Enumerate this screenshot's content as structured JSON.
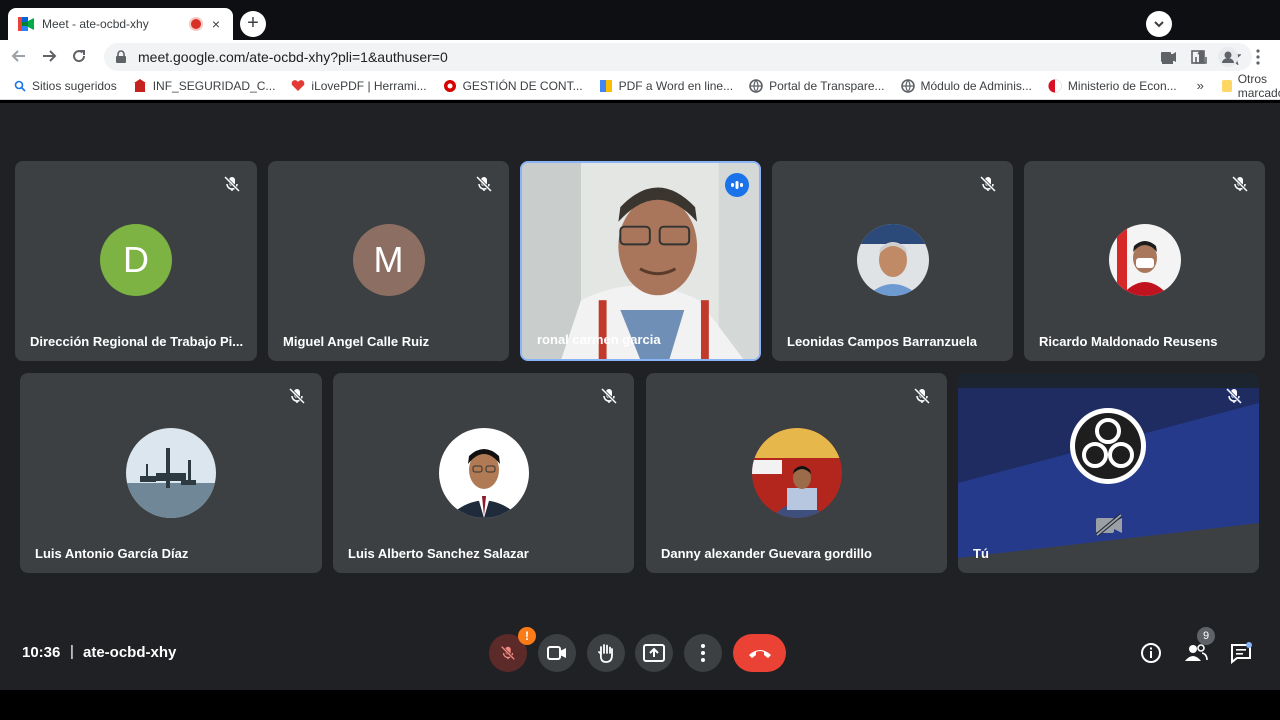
{
  "browser": {
    "tab_title": "Meet - ate-ocbd-xhy",
    "tab_close": "×",
    "new_tab": "+",
    "url": "meet.google.com/ate-ocbd-xhy?pli=1&authuser=0",
    "bookmarks": [
      {
        "label": "Sitios sugeridos",
        "icon": "search-icon",
        "color": "#1a73e8"
      },
      {
        "label": "INF_SEGURIDAD_C...",
        "icon": "building-icon",
        "color": "#c5221f"
      },
      {
        "label": "iLovePDF | Herrami...",
        "icon": "heart-icon",
        "color": "#e53935"
      },
      {
        "label": "GESTIÓN DE CONT...",
        "icon": "circle-logo-icon",
        "color": "#d50000"
      },
      {
        "label": "PDF a Word en line...",
        "icon": "pdf-icon",
        "color": "#fbbc04"
      },
      {
        "label": "Portal de Transpare...",
        "icon": "globe-icon",
        "color": "#5f6368"
      },
      {
        "label": "Módulo de Adminis...",
        "icon": "globe-icon",
        "color": "#5f6368"
      },
      {
        "label": "Ministerio de Econ...",
        "icon": "flag-icon",
        "color": "#d91023"
      }
    ],
    "bookmarks_more": "»",
    "other_bookmarks": "Otros marcadores"
  },
  "participants_row1": [
    {
      "name": "Dirección Regional de Trabajo Pi...",
      "avatar_letter": "D",
      "avatar_color": "#7cb342",
      "muted": true
    },
    {
      "name": "Miguel Angel Calle Ruiz",
      "avatar_letter": "M",
      "avatar_color": "#8d6e63",
      "muted": true
    },
    {
      "name": "ronal carmen garcia",
      "video": true,
      "speaking": true
    },
    {
      "name": "Leonidas Campos Barranzuela",
      "photo": true,
      "muted": true
    },
    {
      "name": "Ricardo Maldonado Reusens",
      "photo": true,
      "muted": true
    }
  ],
  "participants_row2": [
    {
      "name": "Luis Antonio García Díaz",
      "photo": true,
      "muted": true
    },
    {
      "name": "Luis Alberto Sanchez Salazar",
      "photo": true,
      "muted": true
    },
    {
      "name": "Danny alexander Guevara gordillo",
      "photo": true,
      "muted": true
    },
    {
      "name": "Tú",
      "self": true,
      "muted": true,
      "camera_off": true
    }
  ],
  "footer": {
    "time": "10:36",
    "separator": "|",
    "meeting_code": "ate-ocbd-xhy",
    "mic_warning": "!",
    "participant_count": "9"
  },
  "colors": {
    "meet_bg": "#202124",
    "tile_bg": "#3c4043",
    "hangup": "#ea4335",
    "active_border": "#8ab4f8"
  }
}
